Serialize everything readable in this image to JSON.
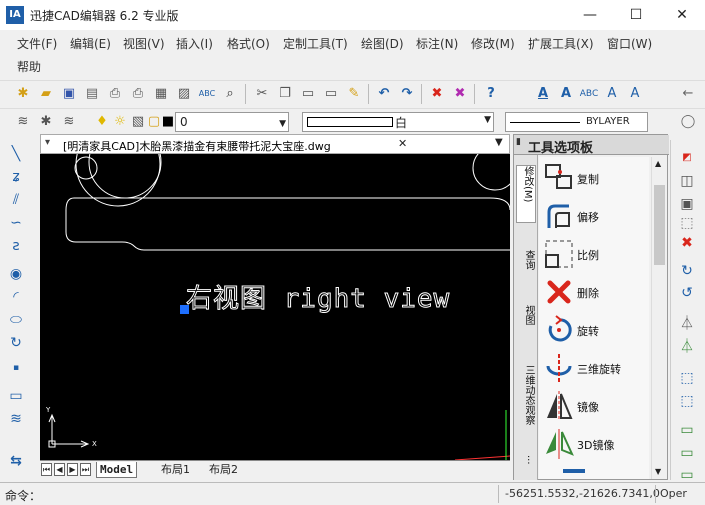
{
  "app": {
    "icon_text": "IA",
    "title": "迅捷CAD编辑器 6.2 专业版"
  },
  "window": {
    "minimize": "—",
    "maximize": "☐",
    "close": "✕"
  },
  "menu": [
    "文件(F)",
    "编辑(E)",
    "视图(V)",
    "插入(I)",
    "格式(O)",
    "定制工具(T)",
    "绘图(D)",
    "标注(N)",
    "修改(M)",
    "扩展工具(X)",
    "窗口(W)",
    "帮助"
  ],
  "toolbar": {
    "layer_value": "0",
    "color_value": "白",
    "linetype_value": "BYLAYER"
  },
  "document": {
    "tab_title": "[明清家具CAD]木胎黑漆描金有束腰带托泥大宝座.dwg",
    "close": "✕"
  },
  "canvas": {
    "text": "右视图 right view",
    "axis_y": "Y",
    "axis_x": "X"
  },
  "layout_tabs": [
    "Model",
    "布局1",
    "布局2"
  ],
  "palette": {
    "title": "工具选项板",
    "tabs": [
      "修改(M)",
      "查询",
      "视图",
      "三维动态观察",
      "..."
    ],
    "items": [
      {
        "label": "复制",
        "icon": "copy-icon"
      },
      {
        "label": "偏移",
        "icon": "offset-icon"
      },
      {
        "label": "比例",
        "icon": "scale-icon"
      },
      {
        "label": "删除",
        "icon": "delete-icon"
      },
      {
        "label": "旋转",
        "icon": "rotate-icon"
      },
      {
        "label": "三维旋转",
        "icon": "3d-rotate-icon"
      },
      {
        "label": "镜像",
        "icon": "mirror-icon"
      },
      {
        "label": "3D镜像",
        "icon": "3d-mirror-icon"
      }
    ]
  },
  "status": {
    "command_label": "命令：",
    "coordinates": "-56251.5532,-21626.7341,0",
    "mode": "Oper"
  },
  "colors": {
    "accent": "#1f5fa8",
    "canvas": "#000000",
    "delete": "#d9261c"
  }
}
